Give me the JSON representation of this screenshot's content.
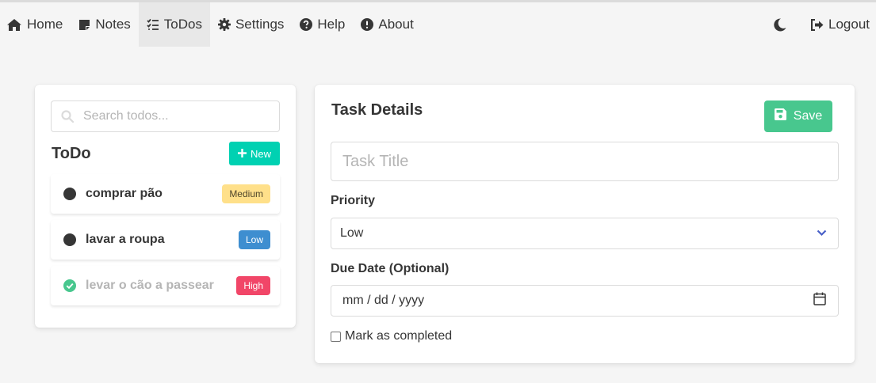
{
  "navbar": {
    "items": [
      {
        "label": "Home",
        "icon": "home-icon"
      },
      {
        "label": "Notes",
        "icon": "sticky-note-icon"
      },
      {
        "label": "ToDos",
        "icon": "tasks-icon",
        "active": true
      },
      {
        "label": "Settings",
        "icon": "gear-icon"
      },
      {
        "label": "Help",
        "icon": "question-circle-icon"
      },
      {
        "label": "About",
        "icon": "info-circle-icon"
      }
    ],
    "theme_icon": "moon-icon",
    "logout_label": "Logout"
  },
  "todo_panel": {
    "search_placeholder": "Search todos...",
    "heading": "ToDo",
    "new_label": "New",
    "items": [
      {
        "label": "comprar pão",
        "priority": "Medium",
        "completed": false
      },
      {
        "label": "lavar a roupa",
        "priority": "Low",
        "completed": false
      },
      {
        "label": "levar o cão a passear",
        "priority": "High",
        "completed": true
      }
    ]
  },
  "task_details": {
    "heading": "Task Details",
    "save_label": "Save",
    "title_placeholder": "Task Title",
    "priority_label": "Priority",
    "priority_value": "Low",
    "due_date_label": "Due Date (Optional)",
    "due_date_placeholder": "mm / dd / yyyy",
    "completed_label": "Mark as completed",
    "completed": false
  },
  "colors": {
    "primary": "#00d1b2",
    "success": "#48c78e",
    "warning": "#ffe08a",
    "info": "#3e8ed0",
    "danger": "#f14668",
    "select_arrow": "#485fc7"
  }
}
